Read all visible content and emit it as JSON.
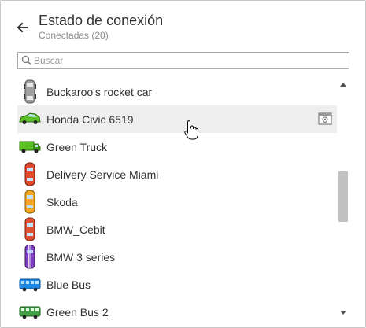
{
  "header": {
    "title": "Estado de conexión",
    "subtitle": "Conectadas (20)"
  },
  "search": {
    "placeholder": "Buscar",
    "value": ""
  },
  "vehicles": [
    {
      "label": "Buckaroo's rocket car",
      "icon": "rocket-car-icon",
      "color": "#9e9e9e"
    },
    {
      "label": "Honda Civic 6519",
      "icon": "green-sedan-icon",
      "color": "#4caf1a"
    },
    {
      "label": "Green Truck",
      "icon": "green-truck-icon",
      "color": "#43a047"
    },
    {
      "label": "Delivery Service Miami",
      "icon": "red-car-icon",
      "color": "#e04a2a"
    },
    {
      "label": "Skoda",
      "icon": "orange-car-icon",
      "color": "#f5a623"
    },
    {
      "label": "BMW_Cebit",
      "icon": "red-car-icon",
      "color": "#e05030"
    },
    {
      "label": "BMW 3 series",
      "icon": "purple-car-icon",
      "color": "#7b3fbf"
    },
    {
      "label": "Blue Bus",
      "icon": "blue-bus-icon",
      "color": "#1e88e5"
    },
    {
      "label": "Green Bus 2",
      "icon": "green-bus-icon",
      "color": "#43a047"
    }
  ],
  "colors": {
    "hover_row": "#eeeeee",
    "border": "#c8c8c8"
  }
}
